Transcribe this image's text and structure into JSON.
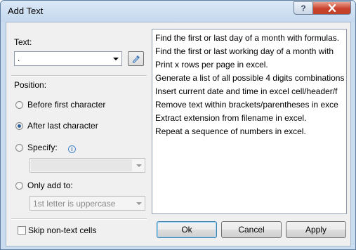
{
  "window": {
    "title": "Add Text"
  },
  "text_field": {
    "label": "Text:",
    "value": "."
  },
  "position": {
    "label": "Position:",
    "options": [
      {
        "label": "Before first character",
        "selected": false
      },
      {
        "label": "After last character",
        "selected": true
      },
      {
        "label": "Specify:",
        "selected": false
      },
      {
        "label": "Only add to:",
        "selected": false
      }
    ],
    "specify_value": "",
    "only_add_to_value": "1st letter is uppercase"
  },
  "skip_non_text": {
    "label": "Skip non-text cells",
    "checked": false
  },
  "list": {
    "items": [
      "Find the first or last day of a month with formulas.",
      "Find the first or last working day of a month with",
      "Print x rows per page in excel.",
      "Generate a list of all possible 4 digits combinations",
      "Insert current date and time in excel cell/header/f",
      "Remove text within brackets/parentheses in exce",
      "Extract extension from filename in excel.",
      "Repeat a sequence of numbers in excel."
    ]
  },
  "buttons": {
    "ok": "Ok",
    "cancel": "Cancel",
    "apply": "Apply"
  },
  "icons": {
    "help": "help-icon",
    "close": "close-icon",
    "picker": "eyedropper-icon",
    "info": "info-icon"
  }
}
